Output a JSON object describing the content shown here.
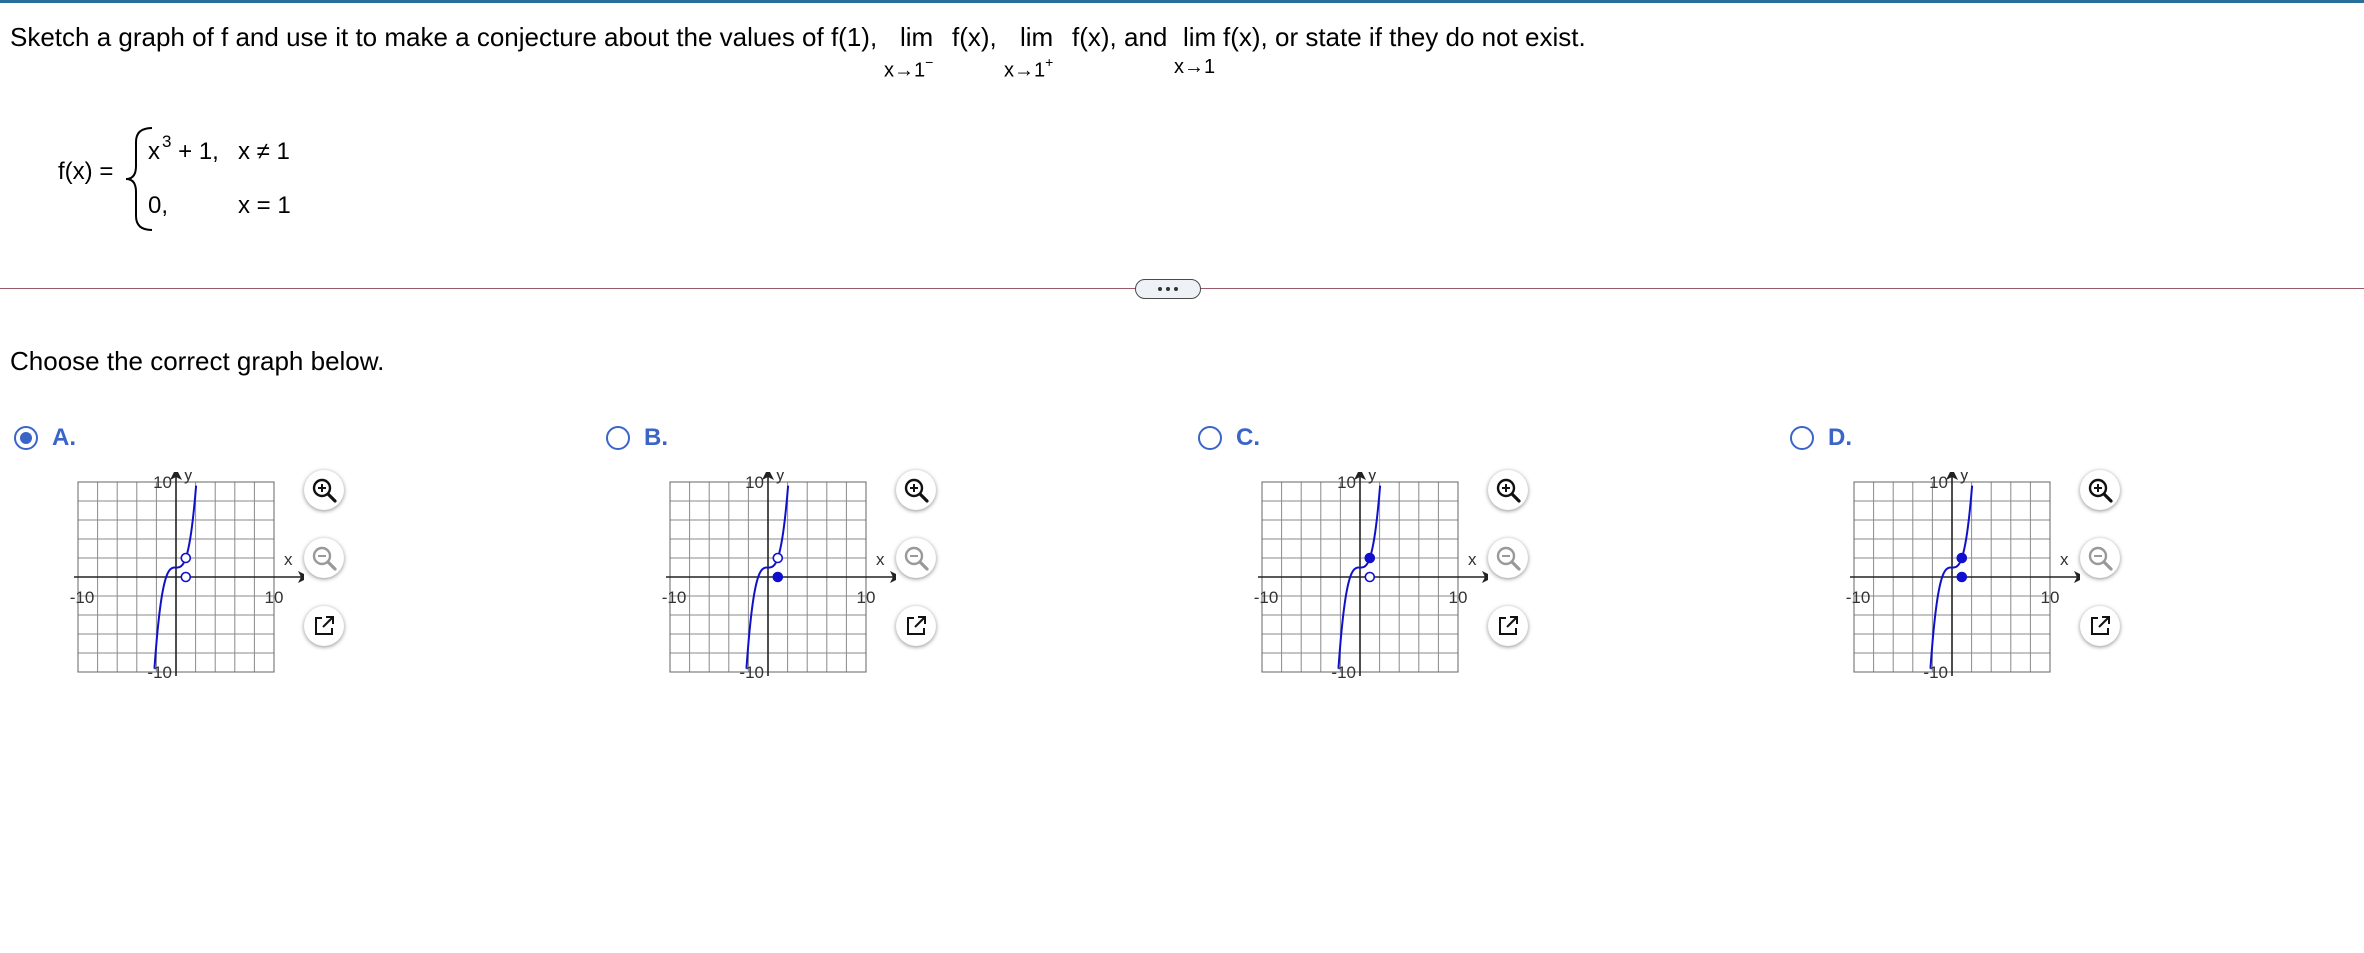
{
  "question": {
    "seg1": "Sketch a graph of f and use it to make a conjecture about the values of f(1),",
    "lim1_word": "lim",
    "lim1_fx": "f(x),",
    "lim1_sub": "x→1",
    "lim1_sup": "−",
    "lim2_word": "lim",
    "lim2_fx": "f(x), and",
    "lim2_sub": "x→1",
    "lim2_sup": "+",
    "lim3_word": "lim",
    "lim3_fx": "f(x), or state if they do not exist.",
    "lim3_sub": "x→1"
  },
  "function": {
    "label": "f(x) =",
    "case1_expr": "x",
    "case1_exp": "3",
    "case1_rest": "+ 1,",
    "case1_cond": "x ≠ 1",
    "case2_expr": "0,",
    "case2_cond": "x = 1"
  },
  "prompt": "Choose the correct graph below.",
  "options": [
    {
      "letter": "A.",
      "selected": true,
      "open_at_y2": true,
      "open_at_y0": true,
      "filled_at_y2": false,
      "filled_at_y0": false
    },
    {
      "letter": "B.",
      "selected": false,
      "open_at_y2": true,
      "open_at_y0": false,
      "filled_at_y2": false,
      "filled_at_y0": true
    },
    {
      "letter": "C.",
      "selected": false,
      "open_at_y2": false,
      "open_at_y0": true,
      "filled_at_y2": true,
      "filled_at_y0": false
    },
    {
      "letter": "D.",
      "selected": false,
      "open_at_y2": false,
      "open_at_y0": false,
      "filled_at_y2": true,
      "filled_at_y0": true
    }
  ],
  "graph_labels": {
    "y_axis": "y",
    "x_axis": "x",
    "y_top": "10",
    "y_bottom": "-10",
    "x_left": "-10",
    "x_right": "10"
  },
  "graph_axes": {
    "xlim": [
      -10,
      10
    ],
    "ylim": [
      -10,
      10
    ],
    "grid_step": 2
  },
  "tools": [
    "zoom-in-icon",
    "zoom-out-icon",
    "open-new-window-icon"
  ],
  "colors": {
    "accent": "#3a64c8",
    "curve": "#1010cc",
    "divider": "#9b5a6a"
  }
}
